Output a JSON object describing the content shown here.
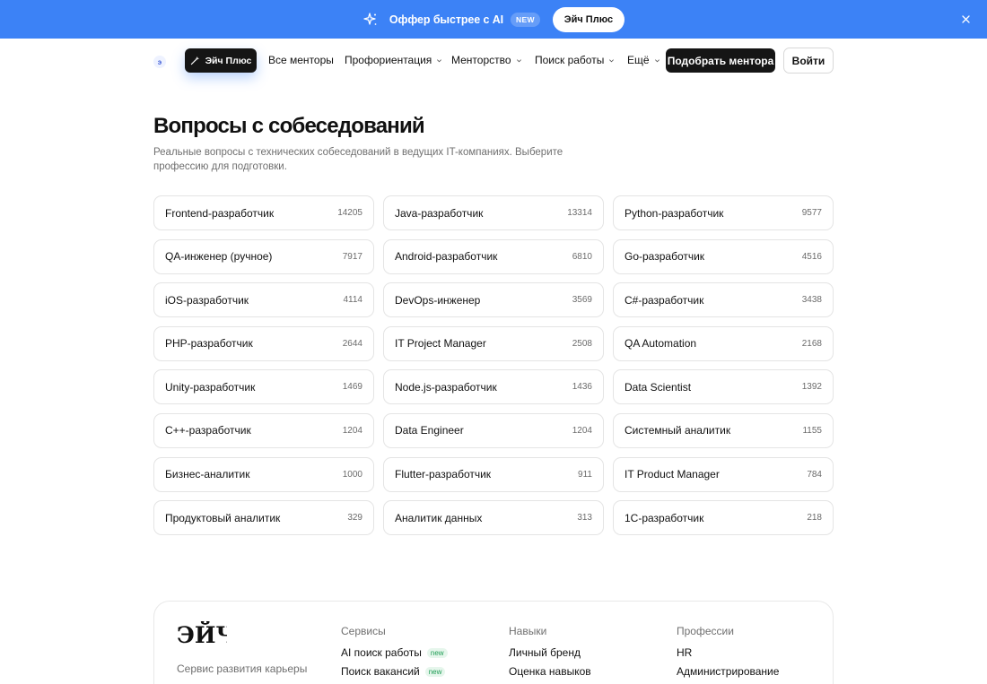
{
  "promo": {
    "text": "Оффер быстрее с AI",
    "badge": "NEW",
    "button": "Эйч Плюс",
    "icon": "sparkle-icon",
    "close_icon": "close-icon"
  },
  "nav": {
    "logo_letter": "э",
    "plus_label": "Эйч Плюс",
    "links": [
      {
        "label": "Все менторы",
        "dropdown": false
      },
      {
        "label": "Профориентация",
        "dropdown": true
      },
      {
        "label": "Менторство",
        "dropdown": true
      },
      {
        "label": "Поиск работы",
        "dropdown": true
      },
      {
        "label": "Ещё",
        "dropdown": true
      }
    ],
    "cta": "Подобрать ментора",
    "login": "Войти"
  },
  "page": {
    "title": "Вопросы с собеседований",
    "subtitle": "Реальные вопросы с технических собеседований в ведущих IT-компаниях. Выберите профессию для подготовки."
  },
  "professions": [
    {
      "title": "Frontend-разработчик",
      "count": "14205"
    },
    {
      "title": "Java-разработчик",
      "count": "13314"
    },
    {
      "title": "Python-разработчик",
      "count": "9577"
    },
    {
      "title": "QA-инженер (ручное)",
      "count": "7917"
    },
    {
      "title": "Android-разработчик",
      "count": "6810"
    },
    {
      "title": "Go-разработчик",
      "count": "4516"
    },
    {
      "title": "iOS-разработчик",
      "count": "4114"
    },
    {
      "title": "DevOps-инженер",
      "count": "3569"
    },
    {
      "title": "C#-разработчик",
      "count": "3438"
    },
    {
      "title": "PHP-разработчик",
      "count": "2644"
    },
    {
      "title": "IT Project Manager",
      "count": "2508"
    },
    {
      "title": "QA Automation",
      "count": "2168"
    },
    {
      "title": "Unity-разработчик",
      "count": "1469"
    },
    {
      "title": "Node.js-разработчик",
      "count": "1436"
    },
    {
      "title": "Data Scientist",
      "count": "1392"
    },
    {
      "title": "C++-разработчик",
      "count": "1204"
    },
    {
      "title": "Data Engineer",
      "count": "1204"
    },
    {
      "title": "Системный аналитик",
      "count": "1155"
    },
    {
      "title": "Бизнес-аналитик",
      "count": "1000"
    },
    {
      "title": "Flutter-разработчик",
      "count": "911"
    },
    {
      "title": "IT Product Manager",
      "count": "784"
    },
    {
      "title": "Продуктовый аналитик",
      "count": "329"
    },
    {
      "title": "Аналитик данных",
      "count": "313"
    },
    {
      "title": "1С-разработчик",
      "count": "218"
    }
  ],
  "footer": {
    "logo": "ЭЙЧ",
    "tagline": "Сервис развития карьеры",
    "columns": [
      {
        "title": "Сервисы",
        "items": [
          {
            "label": "AI поиск работы",
            "badge": "new"
          },
          {
            "label": "Поиск вакансий",
            "badge": "new"
          }
        ]
      },
      {
        "title": "Навыки",
        "items": [
          {
            "label": "Личный бренд",
            "badge": ""
          },
          {
            "label": "Оценка навыков",
            "badge": ""
          }
        ]
      },
      {
        "title": "Профессии",
        "items": [
          {
            "label": "HR",
            "badge": ""
          },
          {
            "label": "Администрирование",
            "badge": ""
          }
        ]
      }
    ]
  },
  "colors": {
    "banner": "#3c82f6",
    "dark": "#151515",
    "new_badge": "#1f9d55"
  }
}
